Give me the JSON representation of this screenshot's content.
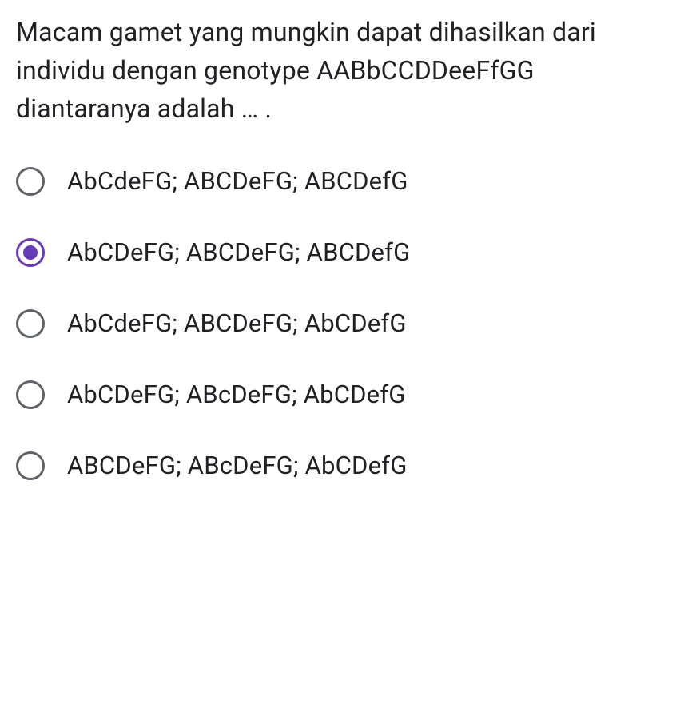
{
  "question": {
    "text": "Macam gamet yang mungkin dapat dihasilkan dari individu dengan genotype AABbCCDDeeFfGG diantaranya adalah … ."
  },
  "options": [
    {
      "label": "AbCdeFG; ABCDeFG; ABCDefG",
      "selected": false
    },
    {
      "label": "AbCDeFG; ABCDeFG; ABCDefG",
      "selected": true
    },
    {
      "label": "AbCdeFG; ABCDeFG; AbCDefG",
      "selected": false
    },
    {
      "label": "AbCDeFG; ABcDeFG; AbCDefG",
      "selected": false
    },
    {
      "label": "ABCDeFG; ABcDeFG; AbCDefG",
      "selected": false
    }
  ]
}
